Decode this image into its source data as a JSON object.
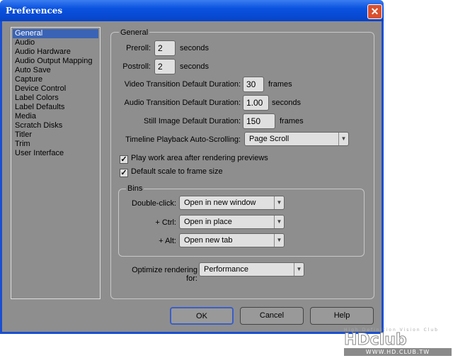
{
  "window": {
    "title": "Preferences",
    "close": "✕"
  },
  "sidebar": {
    "items": [
      "General",
      "Audio",
      "Audio Hardware",
      "Audio Output Mapping",
      "Auto Save",
      "Capture",
      "Device Control",
      "Label Colors",
      "Label Defaults",
      "Media",
      "Scratch Disks",
      "Titler",
      "Trim",
      "User Interface"
    ],
    "selected": "General"
  },
  "general": {
    "group_label": "General",
    "preroll_label": "Preroll:",
    "preroll_value": "2",
    "preroll_unit": "seconds",
    "postroll_label": "Postroll:",
    "postroll_value": "2",
    "postroll_unit": "seconds",
    "video_trans_label": "Video Transition Default Duration:",
    "video_trans_value": "30",
    "video_trans_unit": "frames",
    "audio_trans_label": "Audio Transition Default Duration:",
    "audio_trans_value": "1.00",
    "audio_trans_unit": "seconds",
    "still_label": "Still Image Default Duration:",
    "still_value": "150",
    "still_unit": "frames",
    "scroll_label": "Timeline Playback Auto-Scrolling:",
    "scroll_value": "Page Scroll",
    "play_work_area": "Play work area after rendering previews",
    "default_scale": "Default scale to frame size"
  },
  "bins": {
    "group_label": "Bins",
    "double_click_label": "Double-click:",
    "double_click_value": "Open in new window",
    "ctrl_label": "+ Ctrl:",
    "ctrl_value": "Open in place",
    "alt_label": "+ Alt:",
    "alt_value": "Open new tab"
  },
  "optimize": {
    "label": "Optimize rendering for:",
    "value": "Performance"
  },
  "buttons": {
    "ok": "OK",
    "cancel": "Cancel",
    "help": "Help"
  },
  "watermark": {
    "tagline": "High Definition Vision Club",
    "logo": "HDclub",
    "url": "WWW.HD.CLUB.TW"
  }
}
